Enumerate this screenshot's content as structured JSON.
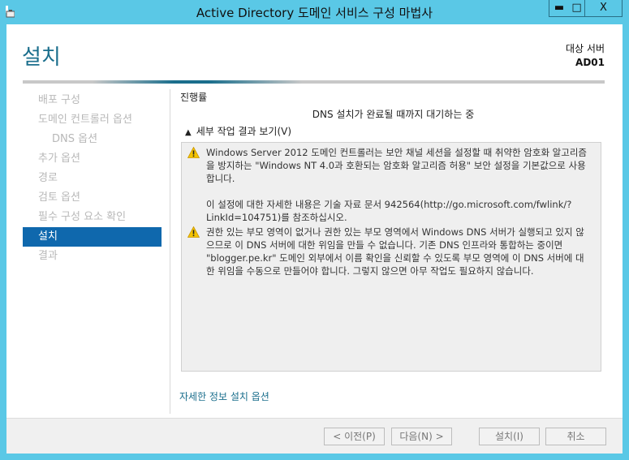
{
  "window": {
    "title": "Active Directory 도메인 서비스 구성 마법사",
    "minimize": "▬",
    "maximize": "□",
    "close": "X"
  },
  "header": {
    "page_title": "설치",
    "target_label": "대상 서버",
    "target_value": "AD01"
  },
  "nav": {
    "items": [
      {
        "label": "배포 구성"
      },
      {
        "label": "도메인 컨트롤러 옵션"
      },
      {
        "label": "DNS 옵션"
      },
      {
        "label": "추가 옵션"
      },
      {
        "label": "경로"
      },
      {
        "label": "검토 옵션"
      },
      {
        "label": "필수 구성 요소 확인"
      },
      {
        "label": "설치",
        "active": true
      },
      {
        "label": "결과"
      }
    ]
  },
  "main": {
    "progress_label": "진행률",
    "status": "DNS 설치가 완료될 때까지 대기하는 중",
    "details_toggle": "세부 작업 결과 보기(V)",
    "messages": [
      {
        "icon": "warning-icon",
        "paragraphs": [
          "Windows Server 2012 도메인 컨트롤러는 보안 채널 세션을 설정할 때 취약한 암호화 알고리즘을 방지하는 \"Windows NT 4.0과 호환되는 암호화 알고리즘 허용\" 보안 설정을 기본값으로 사용합니다.",
          "이 설정에 대한 자세한 내용은 기술 자료 문서 942564(http://go.microsoft.com/fwlink/?LinkId=104751)를 참조하십시오."
        ]
      },
      {
        "icon": "warning-icon",
        "paragraphs": [
          "권한 있는 부모 영역이 없거나 권한 있는 부모 영역에서 Windows DNS 서버가 실행되고 있지 않으므로 이 DNS 서버에 대한 위임을 만들 수 없습니다. 기존 DNS 인프라와 통합하는 중이면 \"blogger.pe.kr\" 도메인 외부에서 이름 확인을 신뢰할 수 있도록 부모 영역에 이 DNS 서버에 대한 위임을 수동으로 만들어야 합니다. 그렇지 않으면 아무 작업도 필요하지 않습니다."
        ]
      }
    ],
    "more_link": "자세한 정보 설치 옵션"
  },
  "footer": {
    "prev": "< 이전(P)",
    "next": "다음(N) >",
    "install": "설치(I)",
    "cancel": "취소"
  },
  "colors": {
    "frame": "#5ac8e6",
    "accent": "#1a6e8c",
    "selected": "#0f68ad",
    "warning": "#f5c400"
  }
}
